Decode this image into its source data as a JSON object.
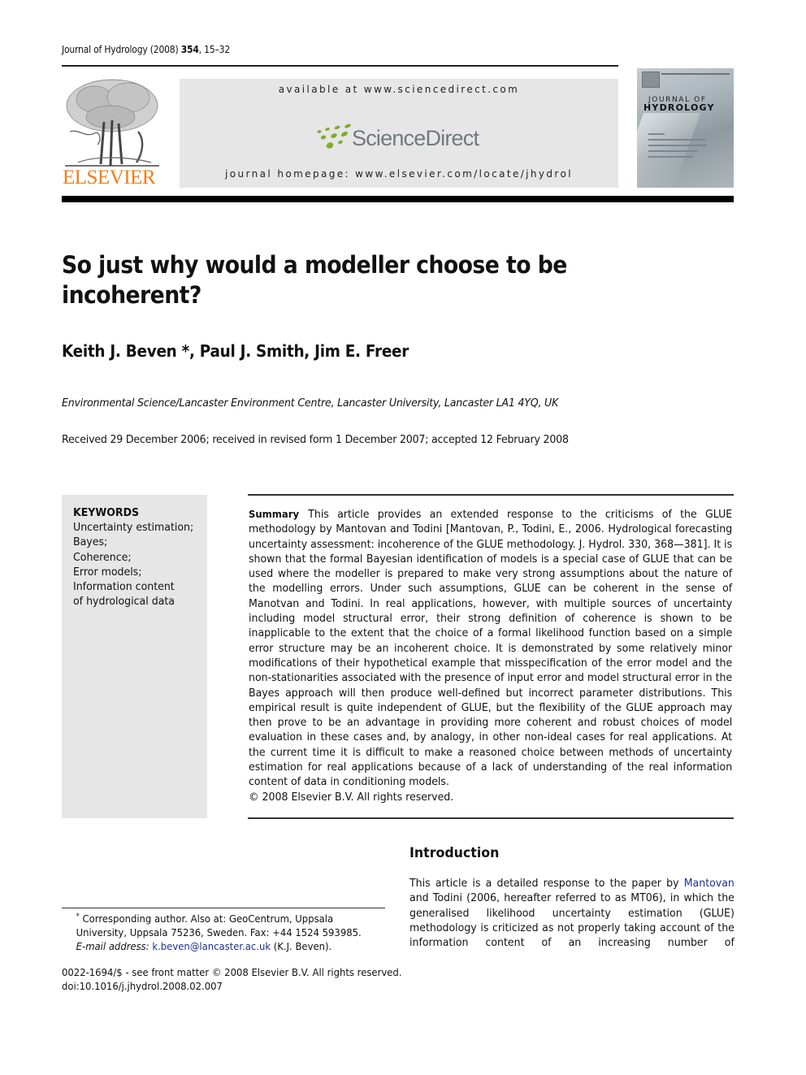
{
  "running_header": {
    "journal": "Journal of Hydrology",
    "year": "(2008)",
    "volume": "354",
    "pages": ", 15–32"
  },
  "masthead": {
    "publisher_logo_text": "ELSEVIER",
    "available_at": "available at www.sciencedirect.com",
    "platform_logo_text": "ScienceDirect",
    "homepage": "journal homepage: www.elsevier.com/locate/jhydrol",
    "cover": {
      "title_line1": "JOURNAL OF",
      "title_line2": "HYDROLOGY"
    },
    "brand_colors": {
      "elsevier_orange": "#f07e1b",
      "sciencedirect_green": "#7fae2a",
      "sciencedirect_gray": "#707a7a"
    }
  },
  "article": {
    "title": "So just why would a modeller choose to be incoherent?",
    "authors": "Keith J. Beven *, Paul J. Smith, Jim E. Freer",
    "affiliation": "Environmental Science/Lancaster Environment Centre, Lancaster University, Lancaster LA1 4YQ, UK",
    "history": "Received 29 December 2006; received in revised form 1 December 2007; accepted 12 February 2008"
  },
  "keywords": {
    "heading": "KEYWORDS",
    "items": [
      "Uncertainty estimation;",
      "Bayes;",
      "Coherence;",
      "Error models;",
      "Information content of hydrological data"
    ]
  },
  "summary": {
    "label": "Summary",
    "text": "This article provides an extended response to the criticisms of the GLUE methodology by Mantovan and Todini [Mantovan, P., Todini, E., 2006. Hydrological forecasting uncertainty assessment: incoherence of the GLUE methodology. J. Hydrol. 330, 368—381]. It is shown that the formal Bayesian identification of models is a special case of GLUE that can be used where the modeller is prepared to make very strong assumptions about the nature of the modelling errors. Under such assumptions, GLUE can be coherent in the sense of Manotvan and Todini. In real applications, however, with multiple sources of uncertainty including model structural error, their strong definition of coherence is shown to be inapplicable to the extent that the choice of a formal likelihood function based on a simple error structure may be an incoherent choice. It is demonstrated by some relatively minor modifications of their hypothetical example that misspecification of the error model and the non-stationarities associated with the presence of input error and model structural error in the Bayes approach will then produce well-defined but incorrect parameter distributions. This empirical result is quite independent of GLUE, but the flexibility of the GLUE approach may then prove to be an advantage in providing more coherent and robust choices of model evaluation in these cases and, by analogy, in other non-ideal cases for real applications. At the current time it is difficult to make a reasoned choice between methods of uncertainty estimation for real applications because of a lack of understanding of the real information content of data in conditioning models.",
    "copyright": "© 2008 Elsevier B.V. All rights reserved."
  },
  "introduction": {
    "heading": "Introduction",
    "text_before_link": "This article is a detailed response to the paper by ",
    "link_text": "Mantovan",
    "text_after_link": " and Todini (2006, hereafter referred to as MT06), in which the generalised likelihood uncertainty estimation (GLUE) methodology is criticized as not properly taking account of the information content of an increasing number of"
  },
  "footnote": {
    "marker": "*",
    "line1": " Corresponding author. Also at: GeoCentrum, Uppsala University, Uppsala 75236, Sweden. Fax: +44 1524 593985.",
    "email_label": "E-mail address:",
    "email": "k.beven@lancaster.ac.uk",
    "email_suffix": " (K.J. Beven)."
  },
  "front_matter": {
    "issn_line": "0022-1694/$ - see front matter © 2008 Elsevier B.V. All rights reserved.",
    "doi": "doi:10.1016/j.jhydrol.2008.02.007"
  }
}
